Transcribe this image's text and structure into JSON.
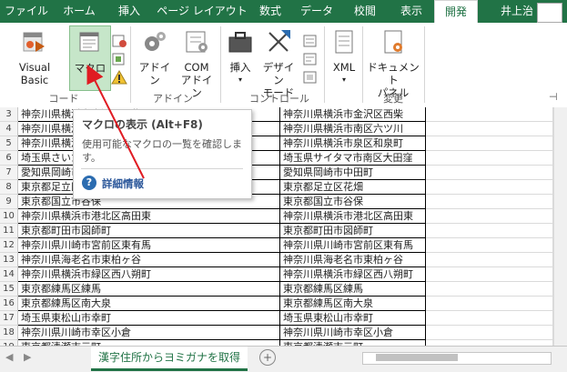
{
  "tabs": [
    "ファイル",
    "ホーム",
    "挿入",
    "ページ レイアウト",
    "数式",
    "データ",
    "校閲",
    "表示",
    "開発"
  ],
  "active_tab": "開発",
  "user_name": "井上治",
  "ribbon": {
    "groups": [
      "コード",
      "アドイン",
      "コントロール",
      "変更"
    ],
    "buttons": {
      "visual_basic": "Visual Basic",
      "macro": "マクロ",
      "addin": "アドイン",
      "com_addin_1": "COM",
      "com_addin_2": "アドイン",
      "insert": "挿入",
      "design_mode_1": "デザイン",
      "design_mode_2": "モード",
      "xml": "XML",
      "doc_panel_1": "ドキュメント",
      "doc_panel_2": "パネル"
    }
  },
  "tooltip": {
    "title": "マクロの表示 (Alt+F8)",
    "description": "使用可能なマクロの一覧を確認します。",
    "help_link": "詳細情報"
  },
  "rows": [
    {
      "n": "3",
      "a": "神奈川県横浜市金沢区西柴",
      "b": "神奈川県横浜市金沢区西柴"
    },
    {
      "n": "4",
      "a": "神奈川県横浜市南区六ツ川",
      "b": "神奈川県横浜市南区六ツ川"
    },
    {
      "n": "5",
      "a": "神奈川県横浜市泉区和泉町",
      "b": "神奈川県横浜市泉区和泉町"
    },
    {
      "n": "6",
      "a": "埼玉県さいたま市南区大田窪",
      "b": "埼玉県サイタマ市南区大田窪"
    },
    {
      "n": "7",
      "a": "愛知県岡崎市中田町",
      "b": "愛知県岡崎市中田町"
    },
    {
      "n": "8",
      "a": "東京都足立区花畑",
      "b": "東京都足立区花畑"
    },
    {
      "n": "9",
      "a": "東京都国立市谷保",
      "b": "東京都国立市谷保"
    },
    {
      "n": "10",
      "a": "神奈川県横浜市港北区高田東",
      "b": "神奈川県横浜市港北区高田東"
    },
    {
      "n": "11",
      "a": "東京都町田市図師町",
      "b": "東京都町田市図師町"
    },
    {
      "n": "12",
      "a": "神奈川県川崎市宮前区東有馬",
      "b": "神奈川県川崎市宮前区東有馬"
    },
    {
      "n": "13",
      "a": "神奈川県海老名市東柏ヶ谷",
      "b": "神奈川県海老名市東柏ヶ谷"
    },
    {
      "n": "14",
      "a": "神奈川県横浜市緑区西八朔町",
      "b": "神奈川県横浜市緑区西八朔町"
    },
    {
      "n": "15",
      "a": "東京都練馬区練馬",
      "b": "東京都練馬区練馬"
    },
    {
      "n": "16",
      "a": "東京都練馬区南大泉",
      "b": "東京都練馬区南大泉"
    },
    {
      "n": "17",
      "a": "埼玉県東松山市幸町",
      "b": "埼玉県東松山市幸町"
    },
    {
      "n": "18",
      "a": "神奈川県川崎市幸区小倉",
      "b": "神奈川県川崎市幸区小倉"
    },
    {
      "n": "19",
      "a": "東京都清瀬市元町",
      "b": "東京都清瀬市元町"
    }
  ],
  "sheet_tab": "漢字住所からヨミガナを取得",
  "colors": {
    "accent": "#217346",
    "arrow": "#e01b22",
    "link": "#2b579a"
  }
}
